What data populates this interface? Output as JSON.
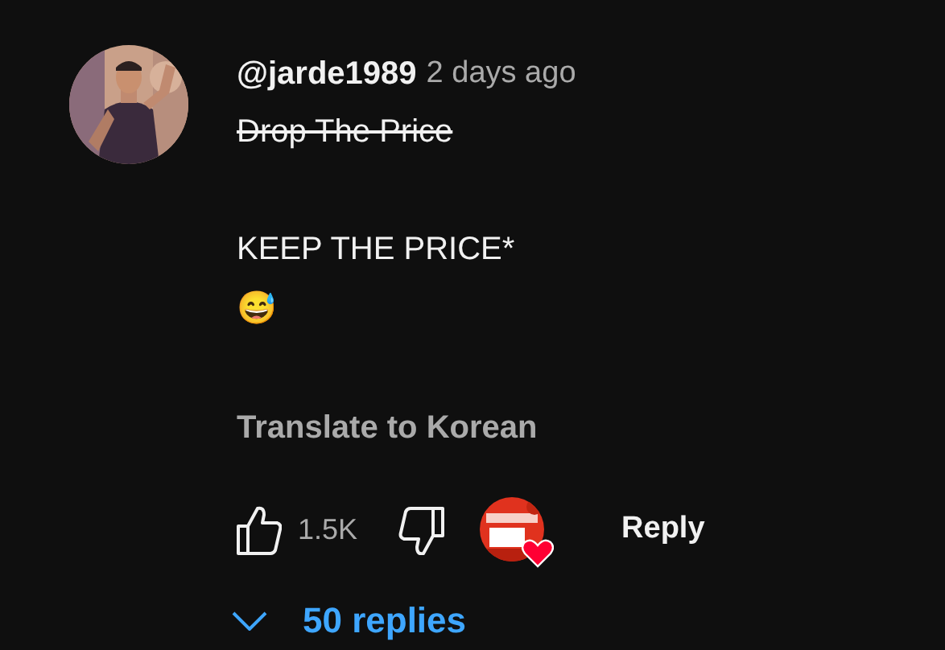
{
  "comment": {
    "author": "@jarde1989",
    "time": "2 days ago",
    "paragraphs": [
      [
        {
          "text": "Drop The Price",
          "strikethrough": true
        }
      ],
      [
        {
          "text": "KEEP THE PRICE*",
          "strikethrough": false
        },
        {
          "text": "😅",
          "strikethrough": false
        }
      ]
    ],
    "translate": "Translate to Korean",
    "likes": "1.5K",
    "creator_heart": true,
    "reply": "Reply",
    "replies": "50 replies"
  }
}
